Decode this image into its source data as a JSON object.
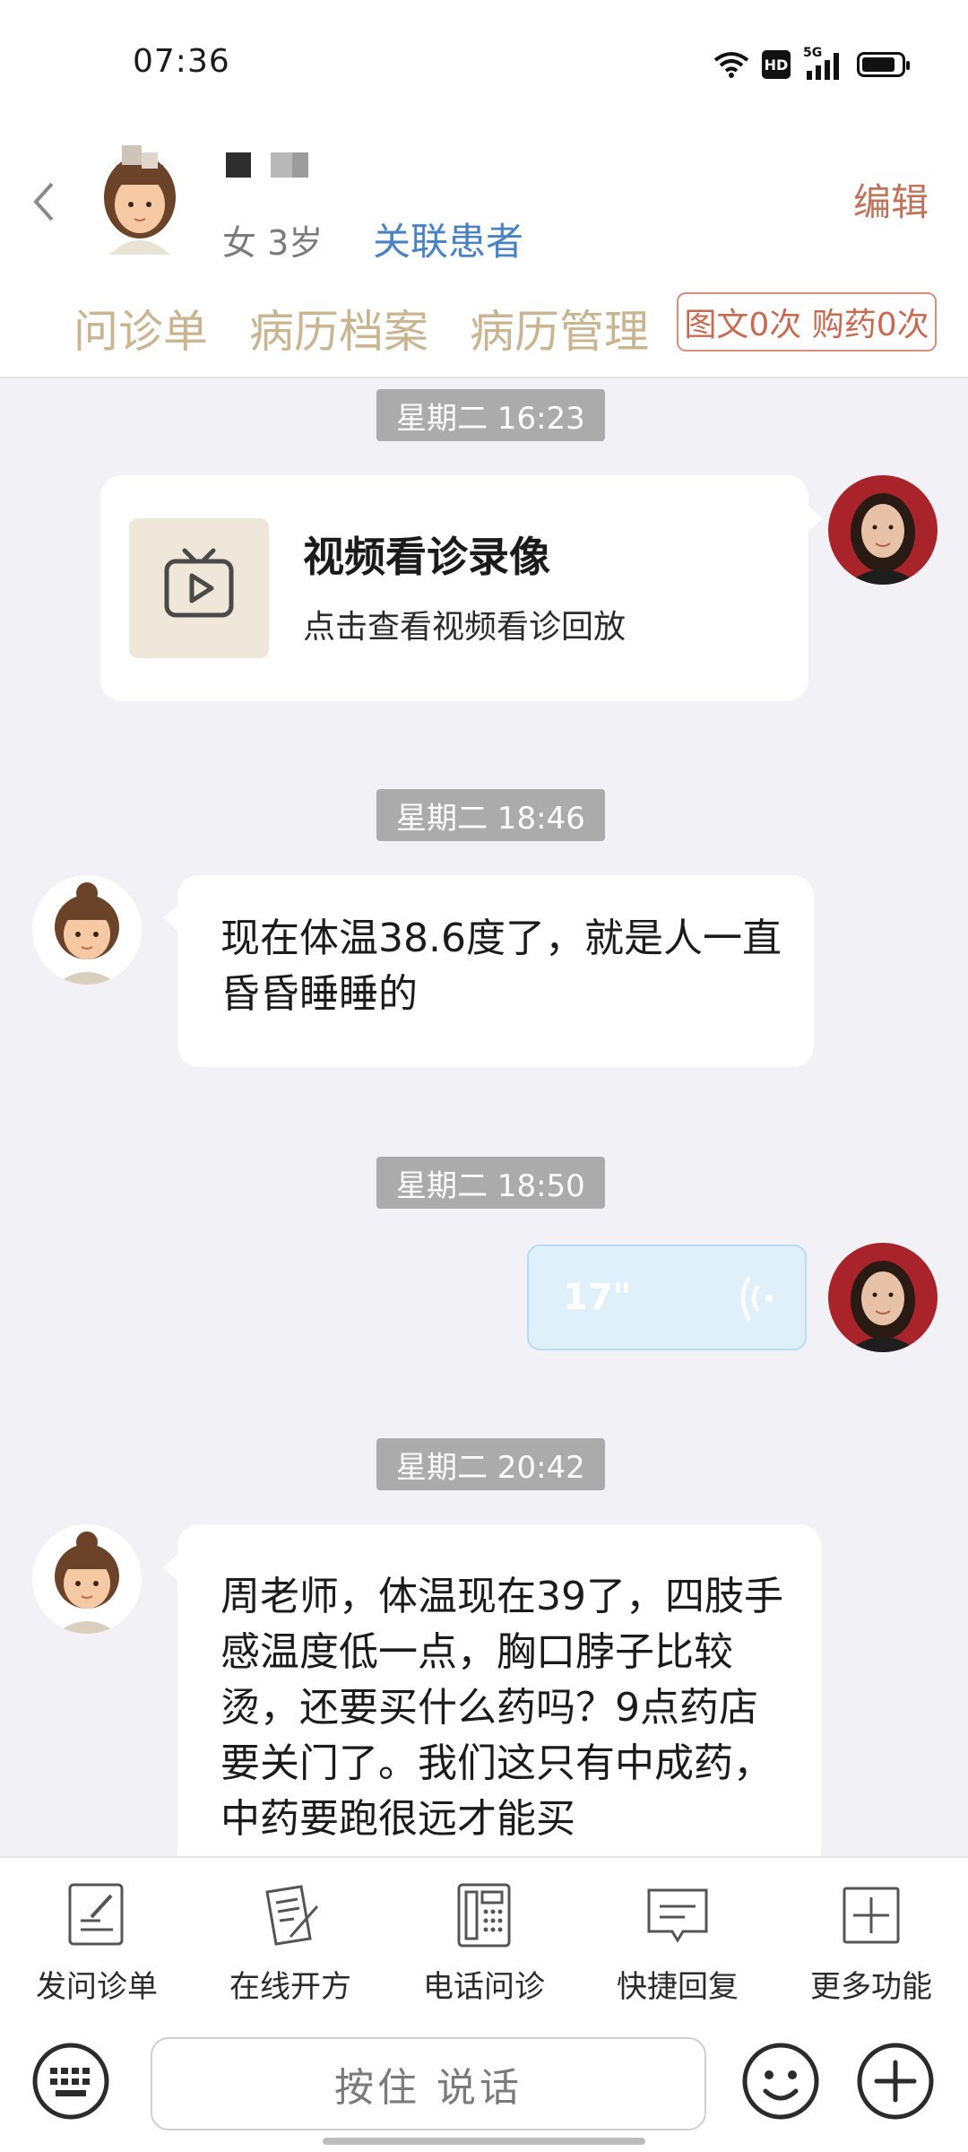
{
  "status_bar": {
    "time": "07:36",
    "network": "5G",
    "hd_badge": "HD"
  },
  "header": {
    "back_icon": "back-arrow-icon",
    "patient": {
      "gender_age": "女 3岁",
      "link_label": "关联患者"
    },
    "edit_label": "编辑",
    "tabs": [
      {
        "label": "问诊单"
      },
      {
        "label": "病历档案"
      },
      {
        "label": "病历管理"
      }
    ],
    "quota_badge": "图文0次 购药0次",
    "colors": {
      "tab": "#c9b591",
      "link": "#4a83c4",
      "edit": "#c0735a"
    }
  },
  "chat": {
    "messages": [
      {
        "time": "星期二 16:23",
        "type": "video",
        "title": "视频看诊录像",
        "subtitle": "点击查看视频看诊回放",
        "sender": "doctor"
      },
      {
        "time": "星期二 18:46",
        "type": "text",
        "text": "现在体温38.6度了，就是人一直昏昏睡睡的",
        "sender": "patient"
      },
      {
        "time": "星期二 18:50",
        "type": "voice",
        "duration": "17\"",
        "sender": "doctor"
      },
      {
        "time": "星期二 20:42",
        "type": "text",
        "text": "周老师，体温现在39了，四肢手感温度低一点，胸口脖子比较烫，还要买什么药吗？9点药店要关门了。我们这只有中成药，中药要跑很远才能买",
        "sender": "patient"
      }
    ]
  },
  "toolbar": {
    "items": [
      {
        "label": "发问诊单",
        "icon": "form-edit-icon"
      },
      {
        "label": "在线开方",
        "icon": "prescription-icon"
      },
      {
        "label": "电话问诊",
        "icon": "phone-icon"
      },
      {
        "label": "快捷回复",
        "icon": "quick-reply-icon"
      },
      {
        "label": "更多功能",
        "icon": "more-plus-icon"
      }
    ]
  },
  "input_bar": {
    "hold_to_talk": "按住 说话",
    "keyboard_icon": "keyboard-icon",
    "emoji_icon": "emoji-icon",
    "plus_icon": "plus-circle-icon"
  }
}
